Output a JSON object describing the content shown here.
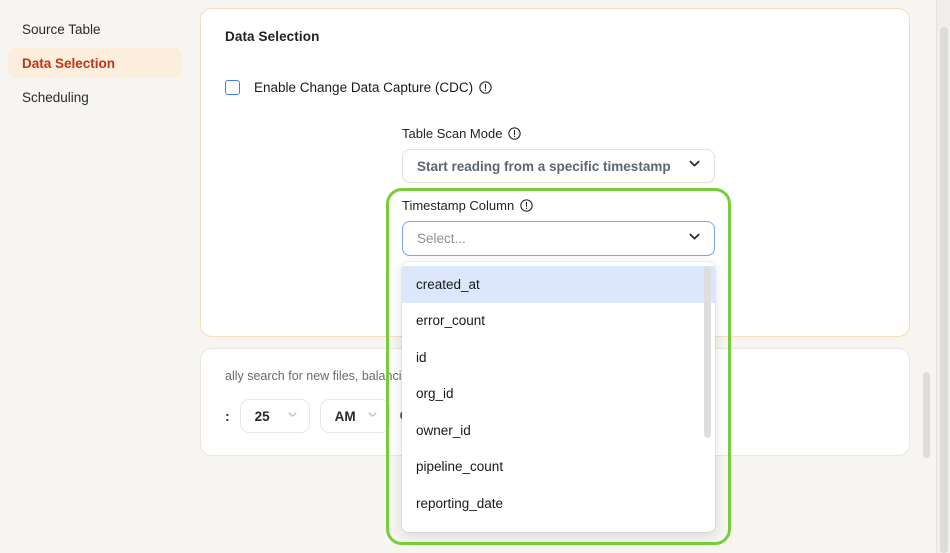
{
  "sidebar": {
    "items": [
      {
        "label": "Source Table",
        "active": false
      },
      {
        "label": "Data Selection",
        "active": true
      },
      {
        "label": "Scheduling",
        "active": false
      }
    ]
  },
  "data_selection_card": {
    "title": "Data Selection",
    "cdc": {
      "label": "Enable Change Data Capture (CDC)",
      "checked": false,
      "info_icon": "info-circle-icon"
    },
    "table_scan_mode": {
      "label": "Table Scan Mode",
      "info_icon": "info-circle-icon",
      "value": "Start reading from a specific timestamp",
      "chevron_icon": "chevron-down-icon"
    },
    "timestamp_column": {
      "label": "Timestamp Column",
      "info_icon": "info-circle-icon",
      "placeholder": "Select...",
      "value": "",
      "chevron_icon": "chevron-down-icon",
      "options": [
        "created_at",
        "error_count",
        "id",
        "org_id",
        "owner_id",
        "pipeline_count",
        "reporting_date"
      ],
      "focused_option": "created_at"
    }
  },
  "scheduling_card": {
    "description": "ally search for new files, balancing frequency with specific time points.",
    "separator": ":",
    "minute": {
      "value": "25",
      "chevron_icon": "chevron-down-icon"
    },
    "meridiem": {
      "value": "AM",
      "chevron_icon": "chevron-down-icon"
    },
    "timezone": "CDT"
  },
  "highlight": {
    "name": "timestamp-column-highlight",
    "color": "#79cc3a"
  },
  "colors": {
    "background": "#f7f5f1",
    "card_border": "#f6dcc0",
    "sidebar_active_bg": "#fceedd",
    "sidebar_active_text": "#c0351a",
    "focus_border": "#7ba4ef",
    "option_focus_bg": "#dce7fb",
    "checkbox_border": "#4a7fe0"
  }
}
